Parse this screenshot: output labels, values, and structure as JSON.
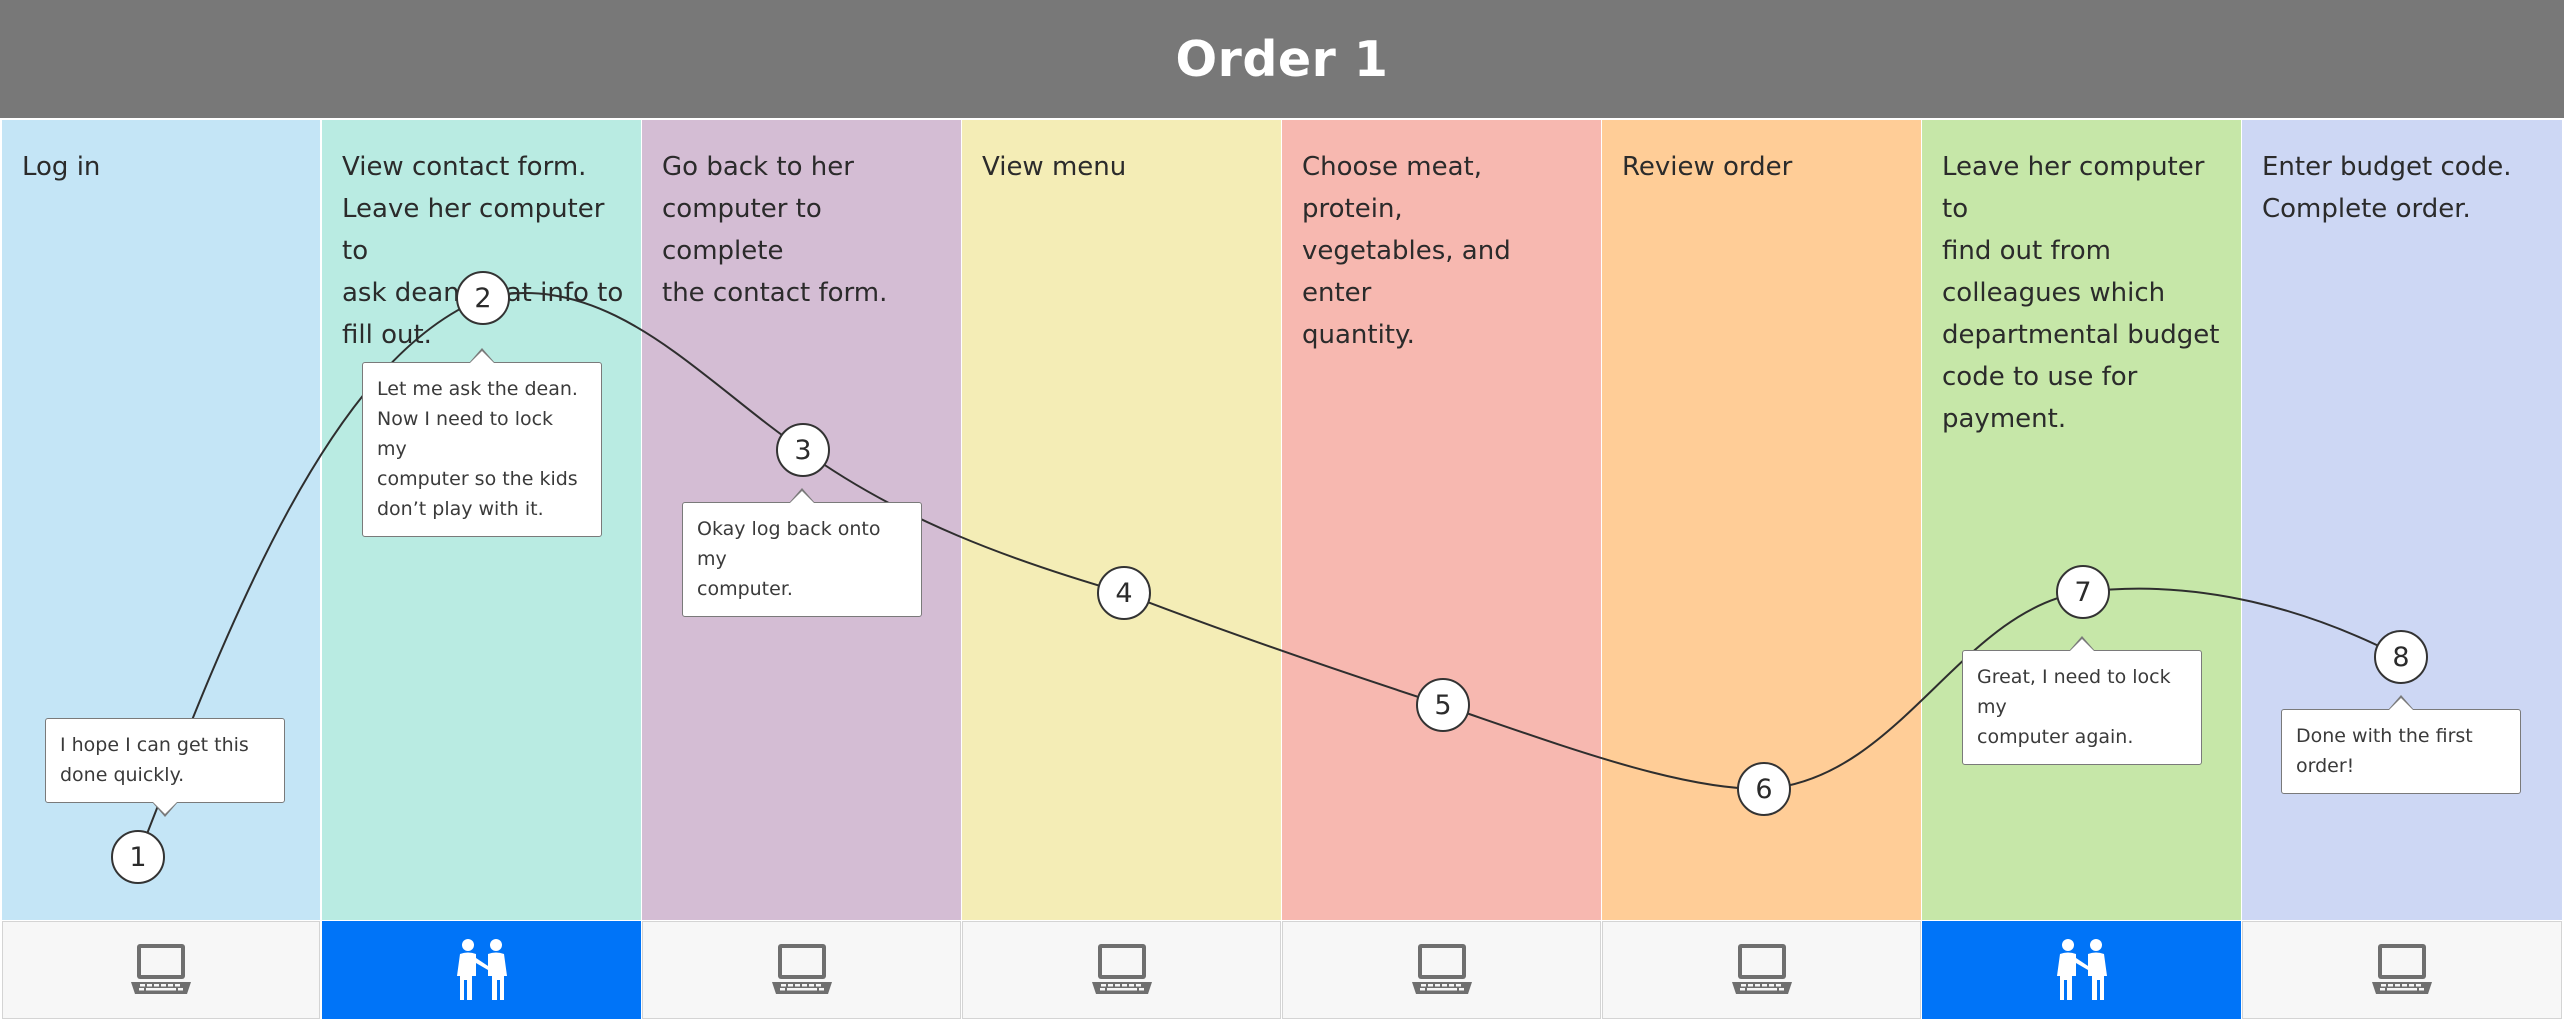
{
  "title": "Order 1",
  "colors": {
    "header": "#787878",
    "people_icon_cell": "#0074f8",
    "computer_icon": "#6f6f6f"
  },
  "stages": [
    {
      "label": "Log in",
      "color": "#c4e5f6",
      "icon": "laptop-icon"
    },
    {
      "label": "View contact form.\nLeave her computer to\nask dean what info to\nfill out.",
      "color": "#b9ebe2",
      "icon": "people-talking-icon"
    },
    {
      "label": "Go back to her\ncomputer to complete\nthe contact form.",
      "color": "#d4bdd4",
      "icon": "laptop-icon"
    },
    {
      "label": "View menu",
      "color": "#f4edb6",
      "icon": "laptop-icon"
    },
    {
      "label": "Choose meat, protein,\nvegetables, and enter\nquantity.",
      "color": "#f7b8b0",
      "icon": "laptop-icon"
    },
    {
      "label": "Review order",
      "color": "#ffcd97",
      "icon": "laptop-icon"
    },
    {
      "label": "Leave her computer to\nfind out from\ncolleagues which\ndepartmental budget\ncode to use for\npayment.",
      "color": "#c6e7a8",
      "icon": "people-talking-icon"
    },
    {
      "label": "Enter budget code.\nComplete order.",
      "color": "#cdd7f4",
      "icon": "laptop-icon"
    }
  ],
  "steps": [
    {
      "number": "1",
      "comment": "I hope I can get this\ndone quickly."
    },
    {
      "number": "2",
      "comment": "Let me ask the dean.\nNow I need to lock my\ncomputer so the kids\ndon’t play with it."
    },
    {
      "number": "3",
      "comment": "Okay log back onto my\ncomputer."
    },
    {
      "number": "4",
      "comment": ""
    },
    {
      "number": "5",
      "comment": ""
    },
    {
      "number": "6",
      "comment": ""
    },
    {
      "number": "7",
      "comment": "Great, I need to lock my\ncomputer again."
    },
    {
      "number": "8",
      "comment": "Done with the first\norder!"
    }
  ]
}
